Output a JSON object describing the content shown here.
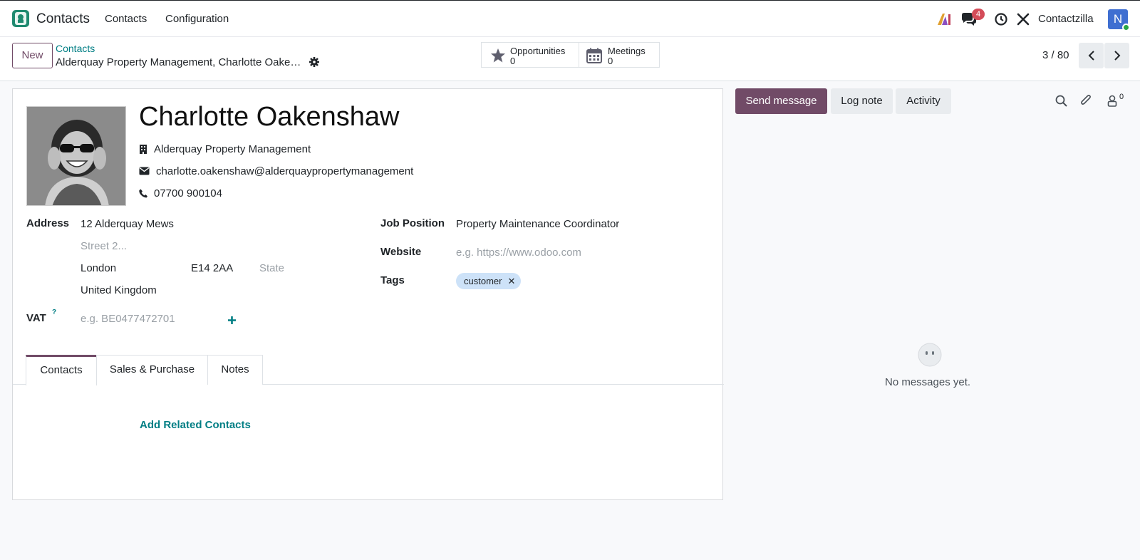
{
  "nav": {
    "app_title": "Contacts",
    "menu": [
      "Contacts",
      "Configuration"
    ],
    "messages_badge": "4",
    "company": "Contactzilla",
    "user_initial": "N"
  },
  "control_panel": {
    "new_label": "New",
    "breadcrumb_parent": "Contacts",
    "breadcrumb_current": "Alderquay Property Management, Charlotte Oakenshaw",
    "smart_buttons": [
      {
        "label": "Opportunities",
        "value": "0"
      },
      {
        "label": "Meetings",
        "value": "0"
      }
    ],
    "pager": "3 / 80"
  },
  "form": {
    "name": "Charlotte Oakenshaw",
    "company": "Alderquay Property Management",
    "email": "charlotte.oakenshaw@alderquaypropertymanagement",
    "phone": "07700 900104",
    "address_label": "Address",
    "street": "12 Alderquay Mews",
    "street2_placeholder": "Street 2...",
    "city": "London",
    "zip": "E14 2AA",
    "state_placeholder": "State",
    "country": "United Kingdom",
    "vat_label": "VAT",
    "vat_help": "?",
    "vat_placeholder": "e.g. BE0477472701",
    "job_position_label": "Job Position",
    "job_position": "Property Maintenance Coordinator",
    "website_label": "Website",
    "website_placeholder": "e.g. https://www.odoo.com",
    "tags_label": "Tags",
    "tags": [
      "customer"
    ],
    "tabs": [
      "Contacts",
      "Sales & Purchase",
      "Notes"
    ],
    "add_related": "Add Related Contacts"
  },
  "chatter": {
    "send_message": "Send message",
    "log_note": "Log note",
    "activity": "Activity",
    "followers_count": "0",
    "empty_text": "No messages yet."
  },
  "colors": {
    "primary": "#714b67",
    "link": "#017e84",
    "badge": "#d44c59",
    "tag_bg": "#cde2f8"
  }
}
